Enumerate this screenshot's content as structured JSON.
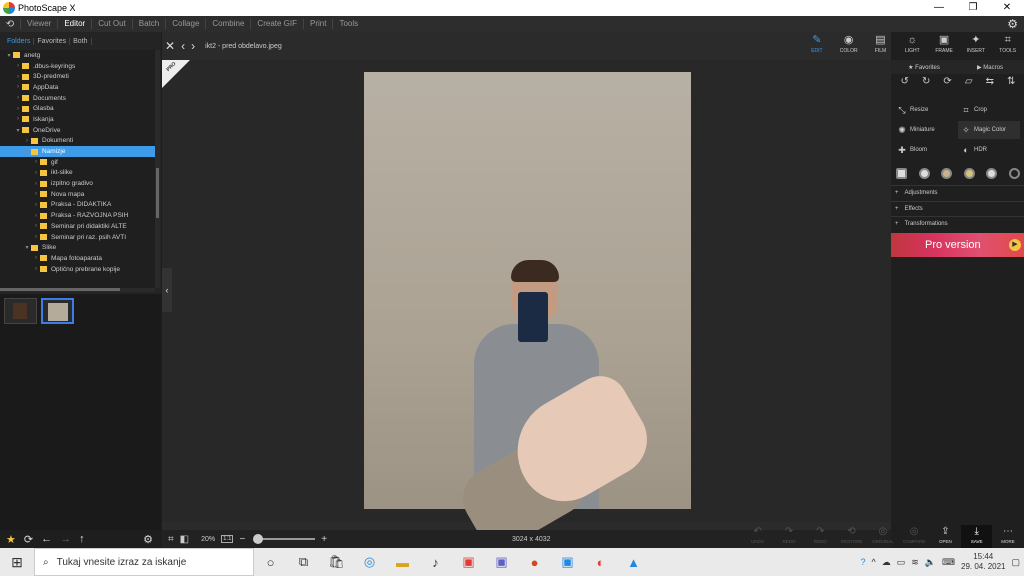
{
  "window": {
    "title": "PhotoScape X",
    "minimize": "—",
    "maximize": "❐",
    "close": "✕"
  },
  "menu": {
    "items": [
      "Viewer",
      "Editor",
      "Cut Out",
      "Batch",
      "Collage",
      "Combine",
      "Create GIF",
      "Print",
      "Tools"
    ],
    "active": "Editor"
  },
  "left": {
    "tabs": [
      "Folders",
      "Favorites",
      "Both"
    ],
    "tree": [
      {
        "label": "anetg",
        "indent": 1,
        "arrow": "▾"
      },
      {
        "label": ".dbus-keyrings",
        "indent": 2,
        "arrow": "›"
      },
      {
        "label": "3D-predmeti",
        "indent": 2,
        "arrow": "›"
      },
      {
        "label": "AppData",
        "indent": 2,
        "arrow": "›"
      },
      {
        "label": "Documents",
        "indent": 2,
        "arrow": "›"
      },
      {
        "label": "Glasba",
        "indent": 2,
        "arrow": "›"
      },
      {
        "label": "Iskanja",
        "indent": 2,
        "arrow": "›"
      },
      {
        "label": "OneDrive",
        "indent": 2,
        "arrow": "▾"
      },
      {
        "label": "Dokumenti",
        "indent": 3,
        "arrow": "›"
      },
      {
        "label": "Namizje",
        "indent": 3,
        "arrow": "▾",
        "selected": true
      },
      {
        "label": "gif",
        "indent": 4,
        "arrow": "›"
      },
      {
        "label": "ikt-slike",
        "indent": 4,
        "arrow": "›"
      },
      {
        "label": "izpitno gradivo",
        "indent": 4,
        "arrow": "›"
      },
      {
        "label": "Nova mapa",
        "indent": 4,
        "arrow": "›"
      },
      {
        "label": "Praksa - DIDAKTIKA",
        "indent": 4,
        "arrow": "›"
      },
      {
        "label": "Praksa - RAZVOJNA PSIH",
        "indent": 4,
        "arrow": "›"
      },
      {
        "label": "Seminar pri didaktiki ALTE",
        "indent": 4,
        "arrow": "›"
      },
      {
        "label": "Seminar pri raz. psih AVTI",
        "indent": 4,
        "arrow": "›"
      },
      {
        "label": "Slike",
        "indent": 3,
        "arrow": "▾"
      },
      {
        "label": "Mapa fotoaparata",
        "indent": 4,
        "arrow": "›"
      },
      {
        "label": "Optično prebrane kopije",
        "indent": 4,
        "arrow": "›"
      }
    ]
  },
  "nav": {
    "close": "✕",
    "prev": "‹",
    "next": "›",
    "filename": "ikt2 - pred obdelavo.jpeg"
  },
  "canvas": {
    "ribbon": "PRO"
  },
  "bottom": {
    "zoom": "20%",
    "fit": "1:1",
    "plus": "+",
    "minus": "−",
    "dims": "3024 x 4032"
  },
  "tools": [
    {
      "label": "EDIT",
      "icon": "✎",
      "active": true
    },
    {
      "label": "COLOR",
      "icon": "◉"
    },
    {
      "label": "FILM",
      "icon": "▤"
    },
    {
      "label": "LIGHT",
      "icon": "☼"
    },
    {
      "label": "FRAME",
      "icon": "▣"
    },
    {
      "label": "INSERT",
      "icon": "✦"
    },
    {
      "label": "TOOLS",
      "icon": "⌗"
    }
  ],
  "right": {
    "fav": "Favorites",
    "macros": "Macros",
    "features": [
      {
        "label": "Resize",
        "icon": "⤡"
      },
      {
        "label": "Crop",
        "icon": "⌗"
      },
      {
        "label": "Miniature",
        "icon": "✺"
      },
      {
        "label": "Magic Color",
        "icon": "✧"
      },
      {
        "label": "Bloom",
        "icon": "✚"
      },
      {
        "label": "HDR",
        "icon": "◐"
      }
    ],
    "sections": [
      "Adjustments",
      "Effects",
      "Transformations"
    ],
    "promo": "Pro version"
  },
  "btools": [
    {
      "label": "UNDO",
      "icon": "↶"
    },
    {
      "label": "REDO",
      "icon": "↷"
    },
    {
      "label": "REDO",
      "icon": "↷"
    },
    {
      "label": "RESTORE",
      "icon": "⟲"
    },
    {
      "label": "ORIGINAL",
      "icon": "◎"
    },
    {
      "label": "COMPARE",
      "icon": "◎"
    },
    {
      "label": "OPEN",
      "icon": "⇪",
      "on": true
    },
    {
      "label": "SAVE",
      "icon": "⤓",
      "save": true
    },
    {
      "label": "MORE",
      "icon": "⋯",
      "on": true
    }
  ],
  "taskbar": {
    "search": "Tukaj vnesite izraz za iskanje",
    "time": "15:44",
    "date": "29. 04. 2021"
  }
}
